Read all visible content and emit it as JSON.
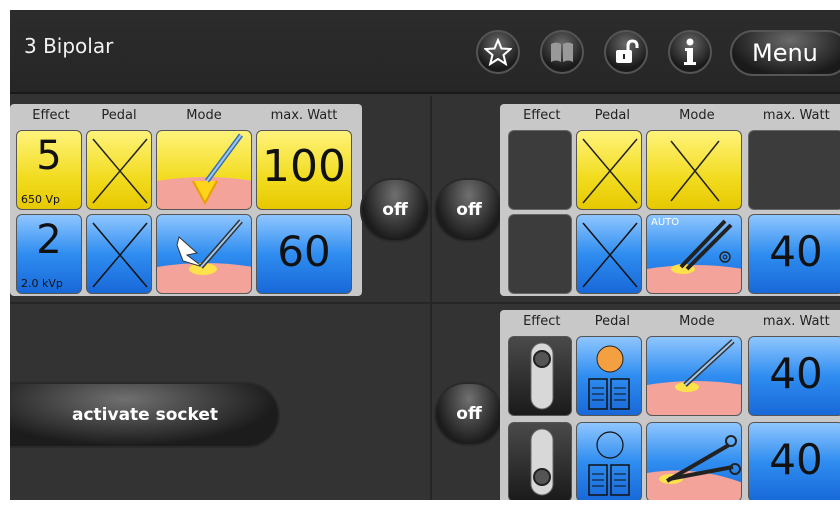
{
  "header": {
    "program_title": "3 Bipolar",
    "menu_label": "Menu",
    "icons": [
      "star-icon",
      "book-icon",
      "unlock-icon",
      "info-icon"
    ]
  },
  "columns": {
    "effect": "Effect",
    "pedal": "Pedal",
    "mode": "Mode",
    "max_watt": "max. Watt"
  },
  "left_socket": {
    "row_top": {
      "effect": "5",
      "effect_sub": "650 Vp",
      "watt": "100"
    },
    "row_bottom": {
      "effect": "2",
      "effect_sub": "2.0 kVp",
      "watt": "60"
    },
    "off_label": "off"
  },
  "right_top_socket": {
    "off_label": "off",
    "row_bottom": {
      "watt": "40",
      "mode_badge": "AUTO"
    }
  },
  "left_bottom": {
    "activate_label": "activate socket"
  },
  "right_bottom_socket": {
    "off_label": "off",
    "row_top": {
      "watt": "40"
    },
    "row_bottom": {
      "watt": "40"
    }
  },
  "colors": {
    "yellow": "#f2dc20",
    "blue": "#2f8df0",
    "background": "#333333"
  }
}
